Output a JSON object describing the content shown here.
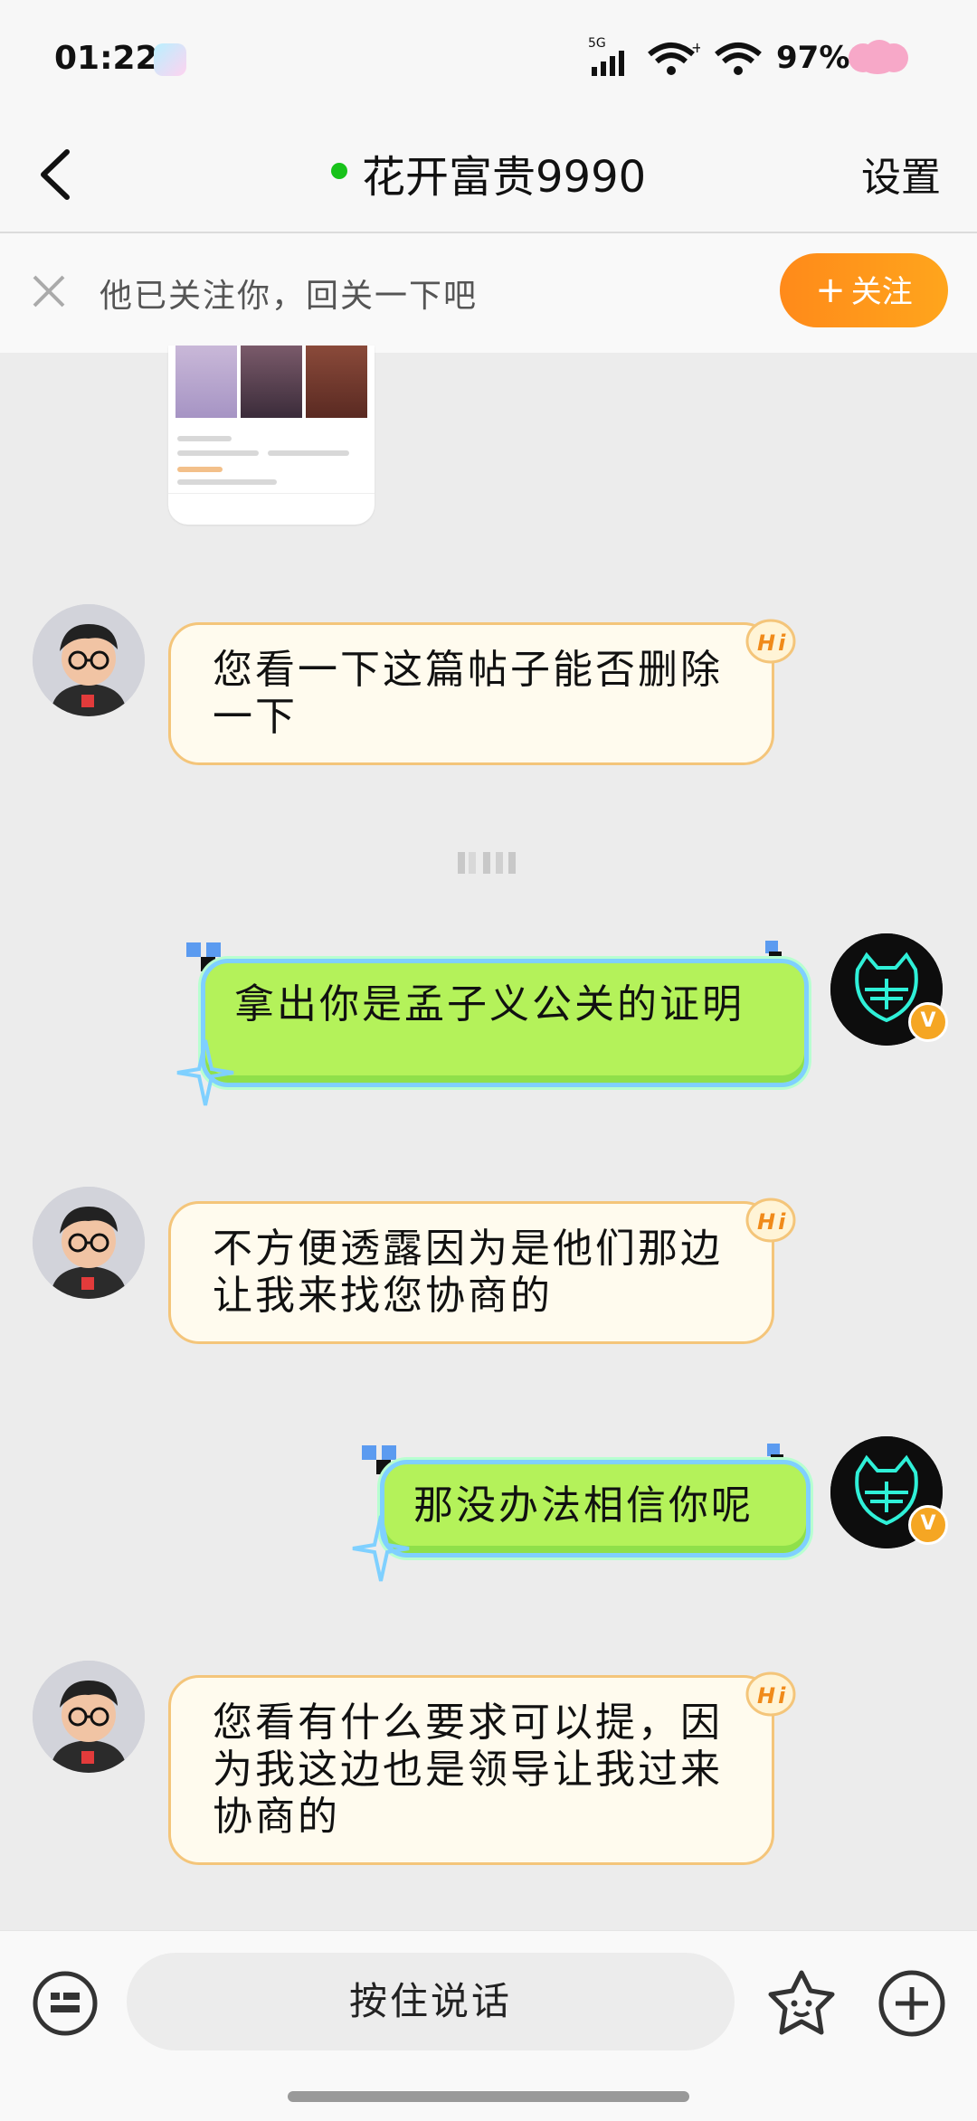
{
  "status_bar": {
    "time": "01:22",
    "network_label": "5G",
    "battery": "97%"
  },
  "header": {
    "title": "花开富贵9990",
    "settings_label": "设置",
    "online_color": "#18c21a"
  },
  "follow_banner": {
    "text": "他已关注你，回关一下吧",
    "button_label": "关注"
  },
  "messages": [
    {
      "side": "left",
      "text": "您看一下这篇帖子能否删除一下",
      "badge": "Hi"
    },
    {
      "side": "right",
      "text": "拿出你是孟子义公关的证明"
    },
    {
      "side": "left",
      "text": "不方便透露因为是他们那边让我来找您协商的",
      "badge": "Hi"
    },
    {
      "side": "right",
      "text": "那没办法相信你呢"
    },
    {
      "side": "left",
      "text": "您看有什么要求可以提，因为我这边也是领导让我过来协商的",
      "badge": "Hi"
    }
  ],
  "bottom_bar": {
    "voice_label": "按住说话"
  },
  "colors": {
    "accent_orange": "#ff8a1a",
    "left_bubble_bg": "#fffbee",
    "right_bubble_bg": "#b4f25a"
  }
}
